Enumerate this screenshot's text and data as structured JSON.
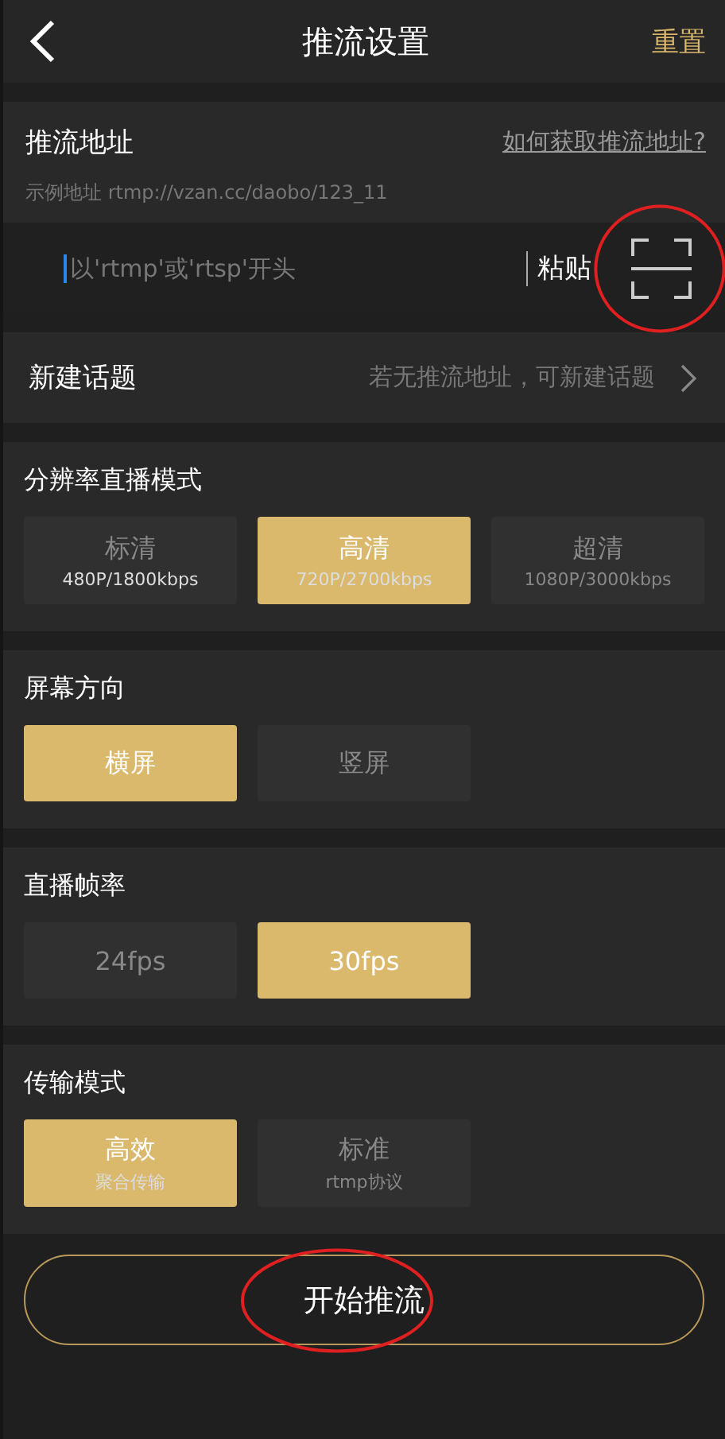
{
  "header": {
    "title": "推流设置",
    "action": "重置"
  },
  "address": {
    "label": "推流地址",
    "help_link": "如何获取推流地址?",
    "example": "示例地址 rtmp://vzan.cc/daobo/123_11",
    "input": {
      "placeholder": "以'rtmp'或'rtsp'开头",
      "focused": true
    },
    "paste": "粘贴",
    "scan": {
      "circled": true
    }
  },
  "topic": {
    "label": "新建话题",
    "hint": "若无推流地址，可新建话题"
  },
  "groups": [
    {
      "title": "分辨率直播模式",
      "options": [
        {
          "label": "标清",
          "sublabel": "480P/1800kbps",
          "selected": false
        },
        {
          "label": "高清",
          "sublabel": "720P/2700kbps",
          "selected": true
        },
        {
          "label": "超清",
          "sublabel": "1080P/3000kbps",
          "selected": false
        }
      ]
    },
    {
      "title": "屏幕方向",
      "options": [
        {
          "label": "横屏",
          "selected": true
        },
        {
          "label": "竖屏",
          "selected": false
        }
      ]
    },
    {
      "title": "直播帧率",
      "options": [
        {
          "label": "24fps",
          "selected": false
        },
        {
          "label": "30fps",
          "selected": true
        }
      ]
    },
    {
      "title": "传输模式",
      "options": [
        {
          "label": "高效",
          "sublabel": "聚合传输",
          "selected": true
        },
        {
          "label": "标准",
          "sublabel": "rtmp协议",
          "selected": false
        }
      ]
    }
  ],
  "start_button": {
    "label": "开始推流",
    "circled": true
  }
}
